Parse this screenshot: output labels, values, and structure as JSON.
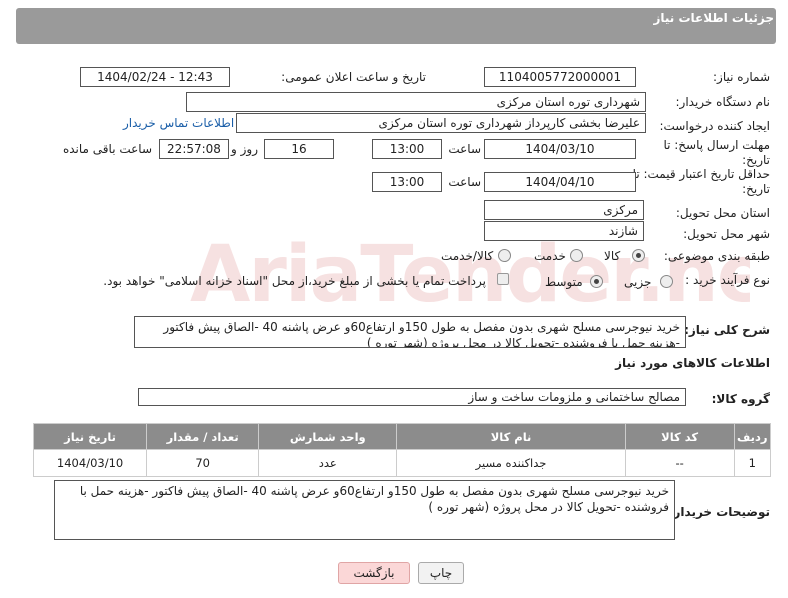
{
  "header": {
    "title": "جزئیات اطلاعات نیاز"
  },
  "watermark": "AriaTender.neT",
  "form": {
    "need_number_label": "شماره نیاز:",
    "need_number": "1104005772000001",
    "announce_label": "تاریخ و ساعت اعلان عمومی:",
    "announce_value": "1404/02/24 - 12:43",
    "buyer_org_label": "نام دستگاه خریدار:",
    "buyer_org": "شهرداری توره استان مرکزی",
    "requester_label": "ایجاد کننده درخواست:",
    "requester": "علیرضا بخشی کارپرداز شهرداری توره استان مرکزی",
    "contact_link": "اطلاعات تماس خریدار",
    "deadline_label": "مهلت ارسال پاسخ: تا تاریخ:",
    "deadline_date": "1404/03/10",
    "time_label": "ساعت",
    "deadline_time": "13:00",
    "days_value": "16",
    "days_label": "روز و",
    "remaining_value": "22:57:08",
    "remaining_label": "ساعت باقی مانده",
    "price_validity_label": "حداقل تاریخ اعتبار قیمت: تا تاریخ:",
    "price_validity_date": "1404/04/10",
    "price_validity_time": "13:00",
    "province_label": "استان محل تحویل:",
    "province": "مرکزی",
    "city_label": "شهر محل تحویل:",
    "city": "شازند",
    "category_label": "طبقه بندی موضوعی:",
    "category_options": [
      "کالا",
      "خدمت",
      "کالا/خدمت"
    ],
    "process_label": "نوع فرآیند خرید :",
    "process_options": [
      "جزیی",
      "متوسط"
    ],
    "payment_note": "پرداخت تمام یا بخشی از مبلغ خرید،از محل \"اسناد خزانه اسلامی\" خواهد بود."
  },
  "description": {
    "label": "شرح کلی نیاز:",
    "text": "خرید نیوجرسی  مسلح شهری  بدون مفصل به طول 150و ارتفاع60و عرض پاشنه 40 -الصاق پیش فاکتور -هزینه حمل با فروشنده -تحویل کالا در محل پروژه (شهر توره )"
  },
  "goods": {
    "section_title": "اطلاعات کالاهای مورد نیاز",
    "group_label": "گروه کالا:",
    "group_value": "مصالح ساختمانی و ملزومات ساخت و ساز",
    "columns": [
      "ردیف",
      "کد کالا",
      "نام کالا",
      "واحد شمارش",
      "تعداد / مقدار",
      "تاریخ نیاز"
    ],
    "rows": [
      [
        "1",
        "--",
        "جداکننده مسیر",
        "عدد",
        "70",
        "1404/03/10"
      ]
    ]
  },
  "buyer_notes": {
    "label": "توضیحات خریدار:",
    "text": "خرید نیوجرسی  مسلح شهری  بدون مفصل به طول 150و ارتفاع60و عرض پاشنه 40 -الصاق پیش فاکتور -هزینه حمل با فروشنده -تحویل کالا در محل پروژه (شهر توره )"
  },
  "buttons": {
    "print": "چاپ",
    "back": "بازگشت"
  }
}
